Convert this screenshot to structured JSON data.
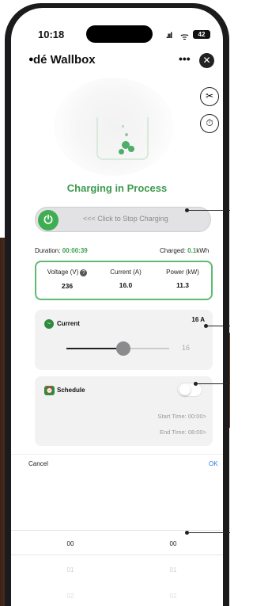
{
  "status_bar": {
    "time": "10:18",
    "signal": ".ııl",
    "wifi": "ᯤ",
    "battery": "42"
  },
  "header": {
    "title": "dé Wallbox",
    "more": "•••",
    "close": "✕"
  },
  "charging": {
    "status": "Charging in Process",
    "stop_label": "<<< Click to Stop Charging"
  },
  "session": {
    "duration_label": "Duration:",
    "duration_value": "00:00:39",
    "charged_label": "Charged:",
    "charged_value": "0.1",
    "charged_unit": "kWh"
  },
  "stats": [
    {
      "label": "Voltage (V)",
      "value": "236",
      "badge": "?"
    },
    {
      "label": "Current (A)",
      "value": "16.0"
    },
    {
      "label": "Power (kW)",
      "value": "11.3"
    }
  ],
  "current_card": {
    "title": "Current",
    "amp_label": "16 A",
    "slider_value": "16",
    "slider_fraction": 0.55
  },
  "schedule_card": {
    "title": "Schedule",
    "enabled": false,
    "start_time": "Start Time: 00:00>",
    "end_time": "End Time: 08:00>"
  },
  "picker": {
    "cancel": "Cancel",
    "ok": "OK",
    "left_values": [
      "00",
      "01",
      "02"
    ],
    "right_values": [
      "00",
      "01",
      "02"
    ]
  },
  "colors": {
    "accent_green": "#3fae53",
    "ok_blue": "#2a7ae2"
  }
}
